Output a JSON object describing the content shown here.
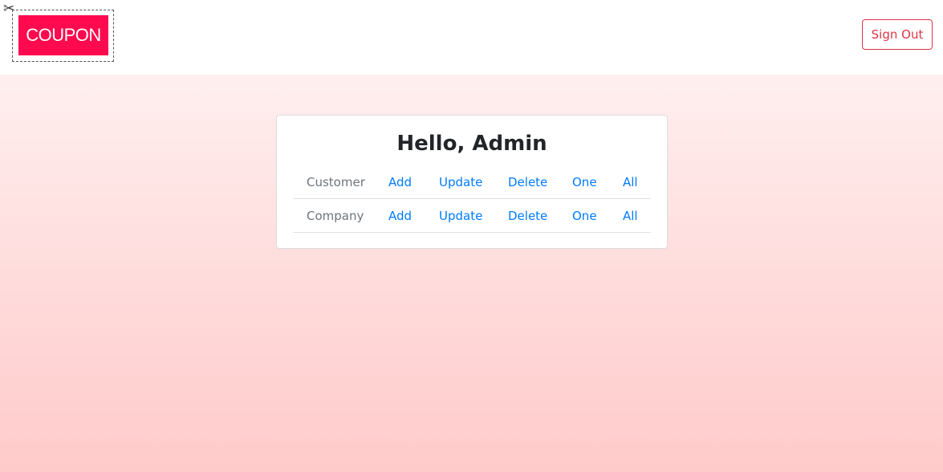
{
  "header": {
    "logo_text": "COUPON",
    "scissors_icon": "scissors-icon",
    "signout_label": "Sign Out"
  },
  "card": {
    "title": "Hello, Admin",
    "rows": [
      {
        "label": "Customer",
        "actions": [
          "Add",
          "Update",
          "Delete",
          "One",
          "All"
        ]
      },
      {
        "label": "Company",
        "actions": [
          "Add",
          "Update",
          "Delete",
          "One",
          "All"
        ]
      }
    ]
  },
  "colors": {
    "brand": "#ff0a4e",
    "danger": "#dc3545",
    "link": "#007bff",
    "muted": "#6c757d"
  }
}
